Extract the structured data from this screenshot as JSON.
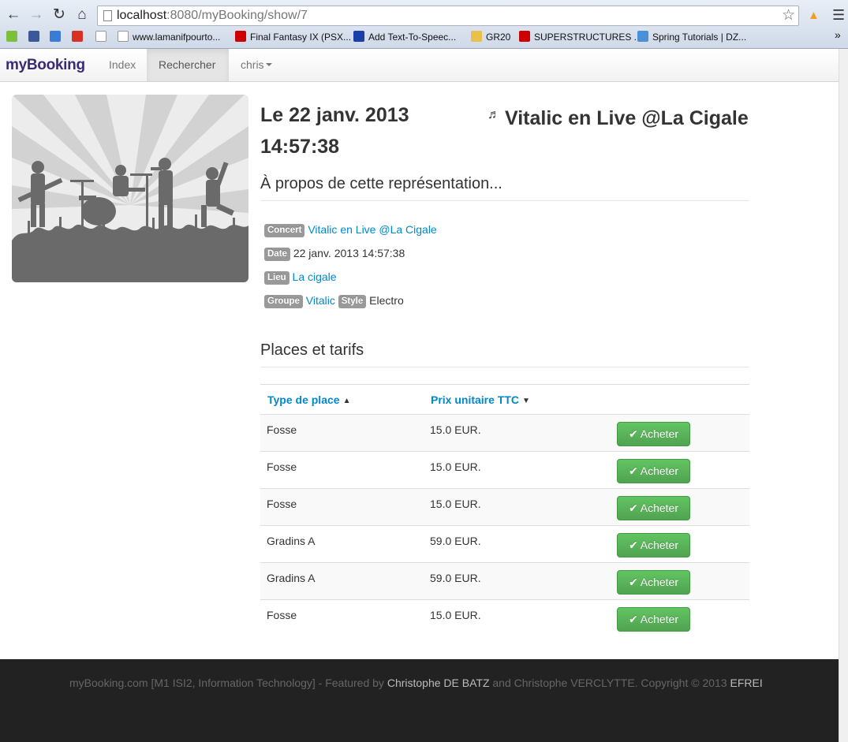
{
  "browser": {
    "url_host": "localhost",
    "url_rest": ":8080/myBooking/show/7",
    "bookmarks": [
      {
        "label": "",
        "color": "#7bbf3a"
      },
      {
        "label": "",
        "color": "#3b5998"
      },
      {
        "label": "",
        "color": "#3a7bd5"
      },
      {
        "label": "",
        "color": "#d93025"
      },
      {
        "label": "",
        "color": "#ffffff"
      },
      {
        "label": "www.lamanifpourto...",
        "color": "#ffffff"
      },
      {
        "label": "Final Fantasy IX (PSX...",
        "color": "#cc0000"
      },
      {
        "label": "Add Text-To-Speec...",
        "color": "#1a3fa8"
      },
      {
        "label": "GR20",
        "color": "#e8c04a"
      },
      {
        "label": "SUPERSTRUCTURES ...",
        "color": "#cc0000"
      },
      {
        "label": "Spring Tutorials | DZ...",
        "color": "#4b8fd6"
      }
    ]
  },
  "navbar": {
    "brand": "myBooking",
    "links": [
      "Index",
      "Rechercher"
    ],
    "user": "chris"
  },
  "event": {
    "title_date": "Le 22 janv. 2013 14:57:38",
    "title_name": "Vitalic en Live @La Cigale",
    "note_glyph": "♬",
    "about_title": "À propos de cette représentation...",
    "concert_label": "Concert",
    "concert_value": "Vitalic en Live @La Cigale",
    "date_label": "Date",
    "date_value": "22 janv. 2013 14:57:38",
    "lieu_label": "Lieu",
    "lieu_value": "La cigale",
    "groupe_label": "Groupe",
    "groupe_value": "Vitalic",
    "style_label": "Style",
    "style_value": "Electro"
  },
  "tarifs": {
    "title": "Places et tarifs",
    "col_type": "Type de place",
    "col_price": "Prix unitaire TTC",
    "buy_label": "Acheter",
    "rows": [
      {
        "type": "Fosse",
        "price": "15.0 EUR."
      },
      {
        "type": "Fosse",
        "price": "15.0 EUR."
      },
      {
        "type": "Fosse",
        "price": "15.0 EUR."
      },
      {
        "type": "Gradins A",
        "price": "59.0 EUR."
      },
      {
        "type": "Gradins A",
        "price": "59.0 EUR."
      },
      {
        "type": "Fosse",
        "price": "15.0 EUR."
      }
    ]
  },
  "footer": {
    "part1": "myBooking.com [M1 ISI2, Information Technology] - Featured by ",
    "author1": "Christophe DE BATZ",
    "part2": " and Christophe VERCLYTTE. Copyright © 2013 ",
    "org": "EFREI"
  }
}
